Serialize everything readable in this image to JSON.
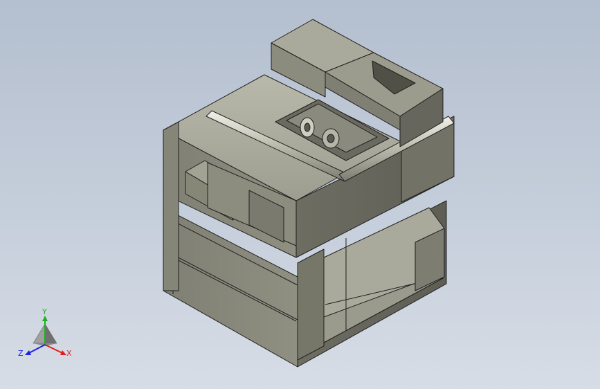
{
  "viewport": {
    "background_top": "#b4bfcf",
    "background_bottom": "#d7dde6"
  },
  "model": {
    "body_color": "#8d8d80",
    "edge_color": "#202020"
  },
  "triad": {
    "x_label": "X",
    "y_label": "Y",
    "z_label": "Z",
    "x_color": "#e02020",
    "y_color": "#20b020",
    "z_color": "#2020e0"
  }
}
